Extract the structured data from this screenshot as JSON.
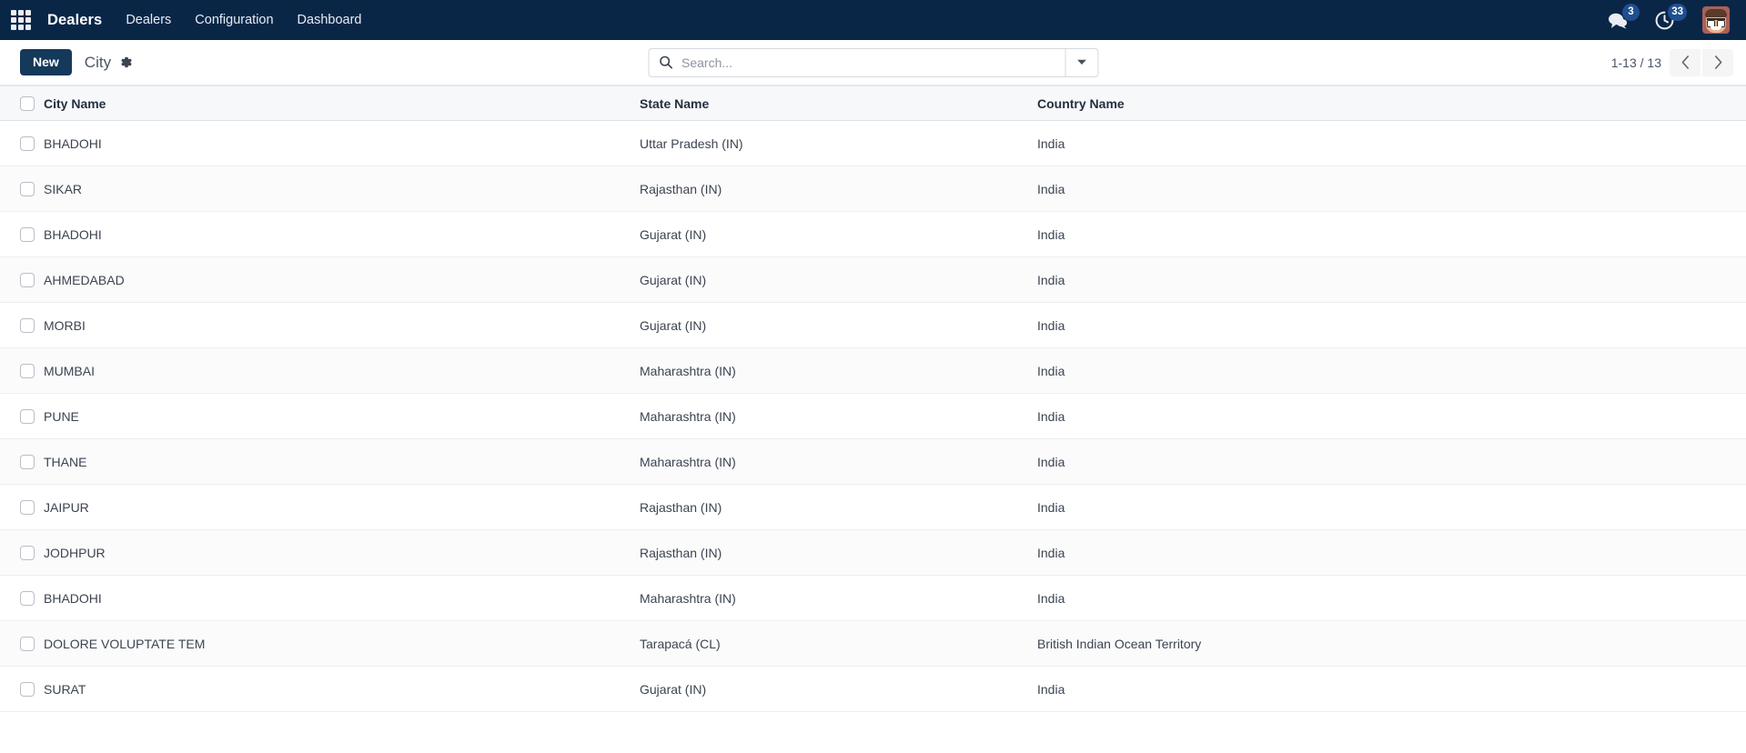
{
  "navbar": {
    "apps_icon": "apps-grid-icon",
    "brand": "Dealers",
    "menu": [
      {
        "label": "Dealers"
      },
      {
        "label": "Configuration"
      },
      {
        "label": "Dashboard"
      }
    ],
    "messages_icon": "messages-icon",
    "messages_badge": "3",
    "activities_icon": "clock-activity-icon",
    "activities_badge": "33",
    "avatar": "user-avatar",
    "background_color": "#0a2647"
  },
  "toolbar": {
    "new_label": "New",
    "title": "City",
    "gear_icon": "gear-icon",
    "new_button_color": "#15395b"
  },
  "search": {
    "icon": "search-icon",
    "placeholder": "Search...",
    "value": "",
    "toggle_icon": "chevron-down-icon"
  },
  "pager": {
    "count": "1-13 / 13",
    "prev_icon": "chevron-left-icon",
    "next_icon": "chevron-right-icon"
  },
  "table": {
    "columns": [
      "City Name",
      "State Name",
      "Country Name"
    ],
    "rows": [
      {
        "city": "BHADOHI",
        "state": "Uttar Pradesh (IN)",
        "country": "India"
      },
      {
        "city": "SIKAR",
        "state": "Rajasthan (IN)",
        "country": "India"
      },
      {
        "city": "BHADOHI",
        "state": "Gujarat (IN)",
        "country": "India"
      },
      {
        "city": "AHMEDABAD",
        "state": "Gujarat (IN)",
        "country": "India"
      },
      {
        "city": "MORBI",
        "state": "Gujarat (IN)",
        "country": "India"
      },
      {
        "city": "MUMBAI",
        "state": "Maharashtra (IN)",
        "country": "India"
      },
      {
        "city": "PUNE",
        "state": "Maharashtra (IN)",
        "country": "India"
      },
      {
        "city": "THANE",
        "state": "Maharashtra (IN)",
        "country": "India"
      },
      {
        "city": "JAIPUR",
        "state": "Rajasthan (IN)",
        "country": "India"
      },
      {
        "city": "JODHPUR",
        "state": "Rajasthan (IN)",
        "country": "India"
      },
      {
        "city": "BHADOHI",
        "state": "Maharashtra (IN)",
        "country": "India"
      },
      {
        "city": "DOLORE VOLUPTATE TEM",
        "state": "Tarapacá (CL)",
        "country": "British Indian Ocean Territory"
      },
      {
        "city": "SURAT",
        "state": "Gujarat (IN)",
        "country": "India"
      }
    ]
  }
}
